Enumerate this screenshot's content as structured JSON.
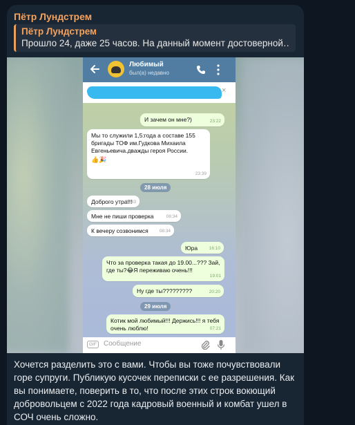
{
  "post": {
    "sender": "Пётр Лундстрем",
    "reply_name": "Пётр Лундстрем",
    "reply_text": "Прошло 24, даже 25 часов. На данный момент достоверной…",
    "caption": "Хочется разделить это с вами. Чтобы вы тоже почувствовали горе супруги. Публикую кусочек переписки с ее разрешения. Как вы понимаете, поверить в то, что после этих строк вокющий добровольцем с 2022 года кадровый военный и комбат ушел в СОЧ очень сложно."
  },
  "screenshot": {
    "chat_name": "Любимый",
    "chat_status": "был(а) недавно",
    "pin_close": "×",
    "messages": [
      {
        "text": "И зачем он мне?)",
        "time": "23:22"
      },
      {
        "text": "Мы то служили 1,5:года а составе 155 бригады ТОФ им.Гудкова Михаила Евгеньевича.дважды героя России.",
        "time": "23:39"
      },
      {
        "date": "28 июля"
      },
      {
        "text": "Доброго утра!!!",
        "time": "08:33"
      },
      {
        "text": "Мне не пиши проверка",
        "time": "08:34"
      },
      {
        "text": "К вечеру созвонимся",
        "time": "08:34"
      },
      {
        "text": "Юра",
        "time": "16:10"
      },
      {
        "text": "Что за проверка такая до 19.00...??? Зай, где ты?😂Я переживаю очень!!!",
        "time": "19:01"
      },
      {
        "text": "Ну где ты?????????",
        "time": "20:20"
      },
      {
        "date": "29 июля"
      },
      {
        "text": "Котик мой любимый!!! Держись!!! я тебя очень люблю!",
        "time": "07:21"
      }
    ],
    "input_placeholder": "Сообщение",
    "gif_label": "GIF"
  },
  "colors": {
    "accent": "#f5a25d",
    "bubble_bg": "#182533",
    "page_bg": "#0e1621",
    "tg_header": "#517da2"
  }
}
